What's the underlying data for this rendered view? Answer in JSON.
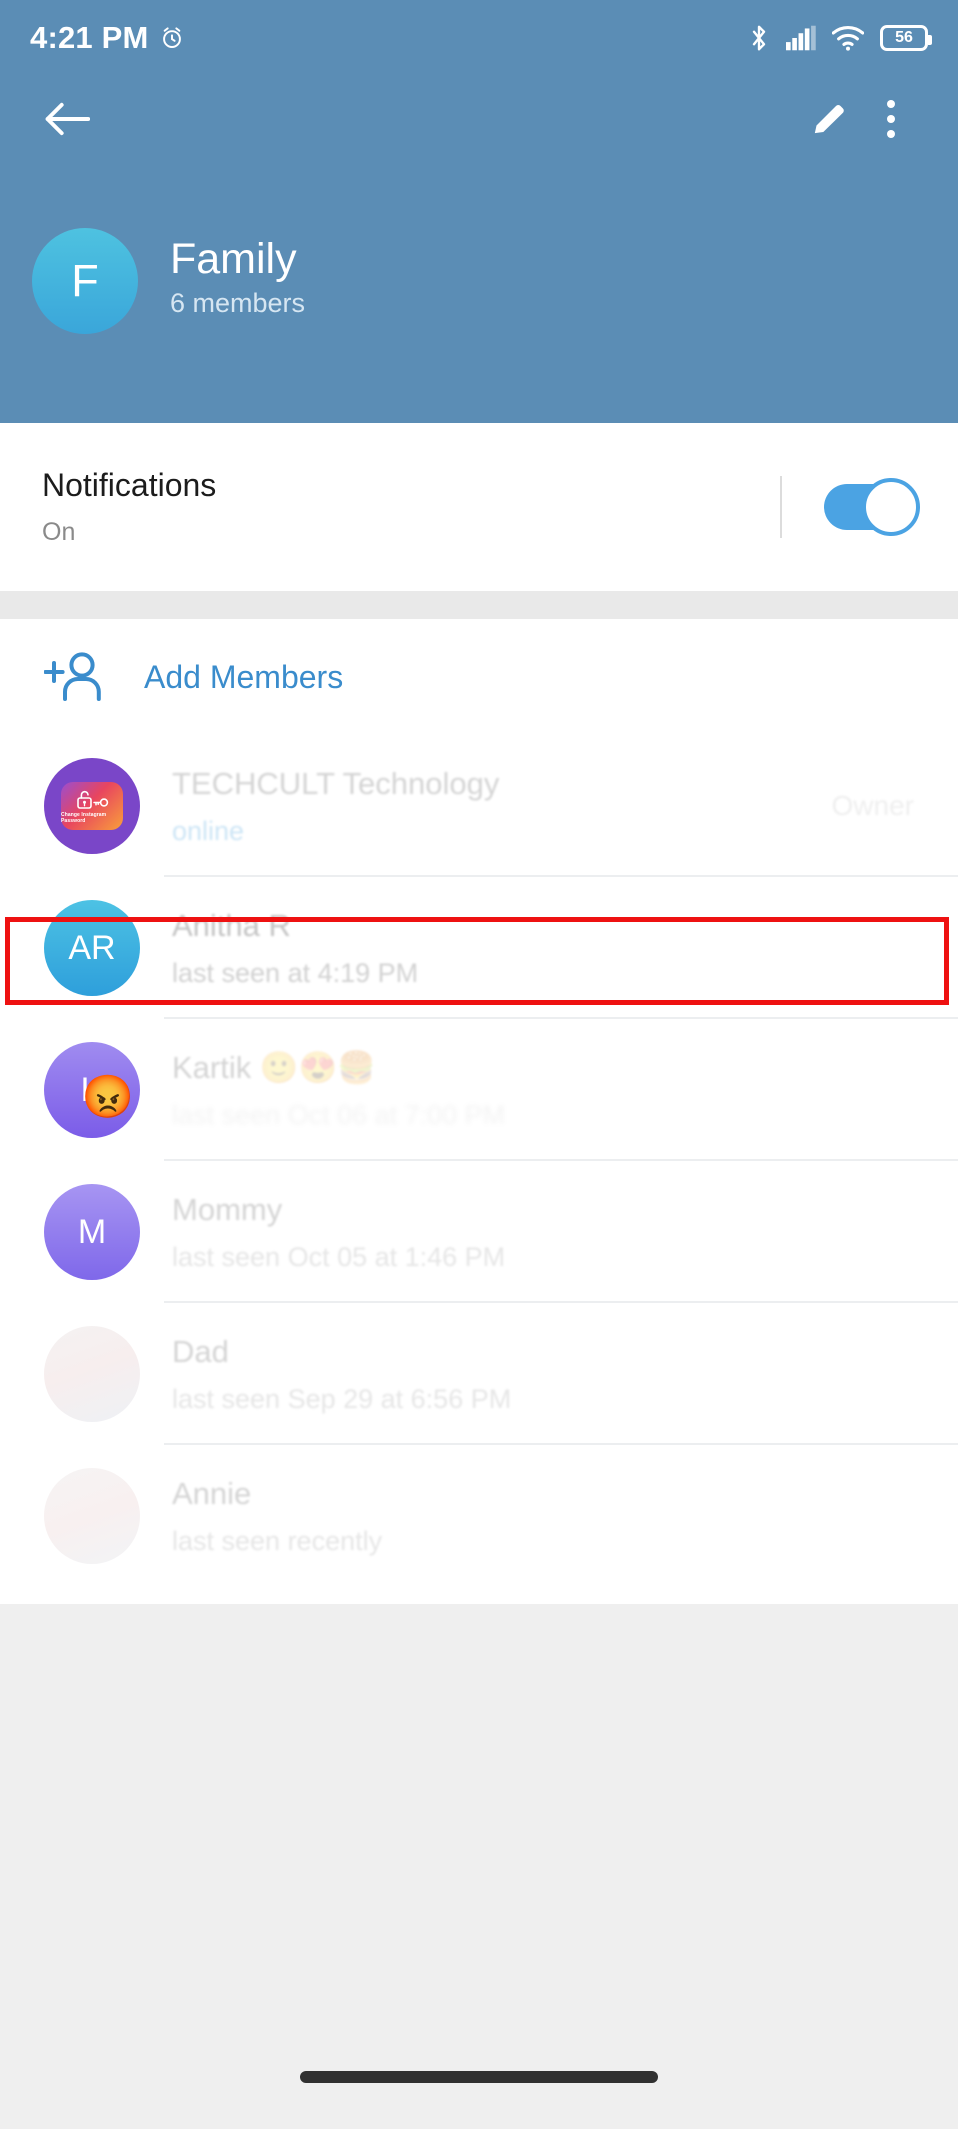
{
  "status_bar": {
    "time": "4:21 PM",
    "alarm_icon": "alarm-clock-icon",
    "bluetooth_icon": "bluetooth-icon",
    "signal_icon": "cellular-signal-icon",
    "wifi_icon": "wifi-icon",
    "battery_level": "56"
  },
  "app_bar": {
    "back_icon": "back-arrow-icon",
    "edit_icon": "pencil-edit-icon",
    "menu_icon": "overflow-menu-icon"
  },
  "group": {
    "avatar_initial": "F",
    "title": "Family",
    "subtitle": "6 members"
  },
  "notifications": {
    "title": "Notifications",
    "value": "On",
    "toggle_state": "on"
  },
  "add_members": {
    "label": "Add Members",
    "icon": "add-person-icon"
  },
  "members": [
    {
      "name": "TECHCULT Technology",
      "status": "online",
      "status_type": "online",
      "role": "Owner",
      "avatar_type": "image",
      "avatar_initial": "",
      "avatar_caption": "Change Instagram Password"
    },
    {
      "name": "Anitha R",
      "status": "last seen at 4:19 PM",
      "status_type": "offline",
      "role": "",
      "avatar_type": "initial",
      "avatar_initial": "AR",
      "highlighted": "true"
    },
    {
      "name": "Kartik 🙂😍🍔",
      "status": "last seen Oct 06 at 7:00 PM",
      "status_type": "offline",
      "role": "",
      "avatar_type": "initial",
      "avatar_initial": "K",
      "avatar_emoji": "😡"
    },
    {
      "name": "Mommy",
      "status": "last seen Oct 05 at 1:46 PM",
      "status_type": "offline",
      "role": "",
      "avatar_type": "initial",
      "avatar_initial": "M"
    },
    {
      "name": "Dad",
      "status": "last seen Sep 29 at 6:56 PM",
      "status_type": "offline",
      "role": "",
      "avatar_type": "photo",
      "avatar_initial": ""
    },
    {
      "name": "Annie",
      "status": "last seen recently",
      "status_type": "offline",
      "role": "",
      "avatar_type": "photo",
      "avatar_initial": ""
    }
  ],
  "colors": {
    "header_blue": "#5b8db5",
    "accent_blue": "#3a8ccc",
    "toggle_on": "#4ba3e3",
    "highlight_red": "#ee1111",
    "page_gray": "#efefef"
  }
}
